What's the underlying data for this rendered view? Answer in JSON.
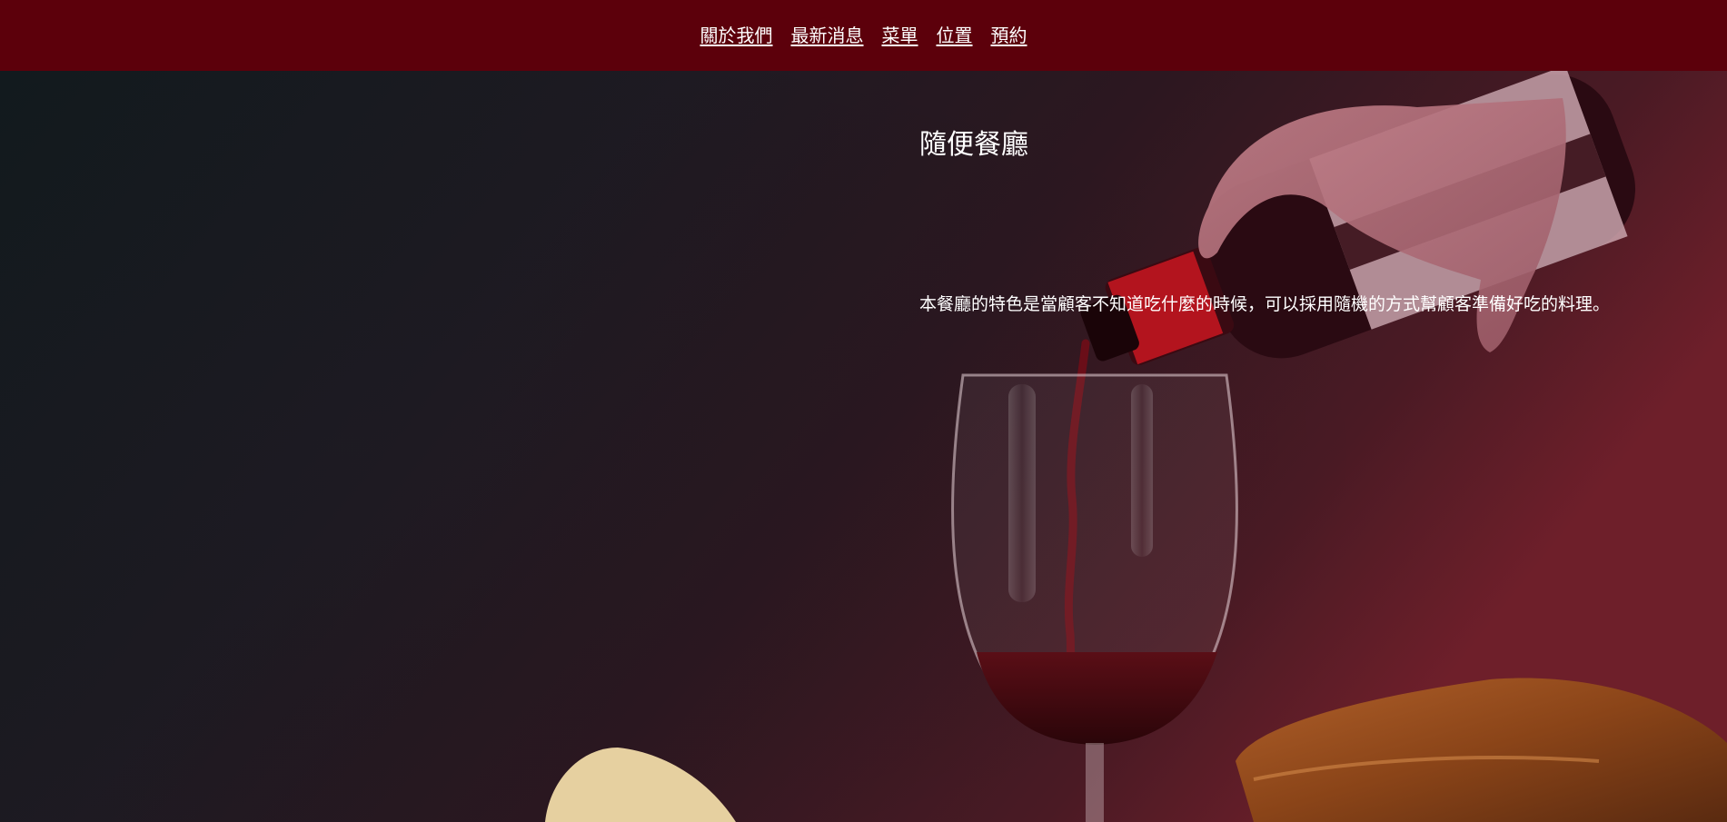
{
  "nav": {
    "items": [
      {
        "label": "關於我們"
      },
      {
        "label": "最新消息"
      },
      {
        "label": "菜單"
      },
      {
        "label": "位置"
      },
      {
        "label": "預約"
      }
    ]
  },
  "hero": {
    "title": "隨便餐廳",
    "description": "本餐廳的特色是當顧客不知道吃什麼的時候，可以採用隨機的方式幫顧客準備好吃的料理。"
  },
  "colors": {
    "navbar_bg": "#5c000b",
    "text": "#ffffff",
    "hero_dark": "#141a1e",
    "hero_wine": "#6e1c28"
  }
}
